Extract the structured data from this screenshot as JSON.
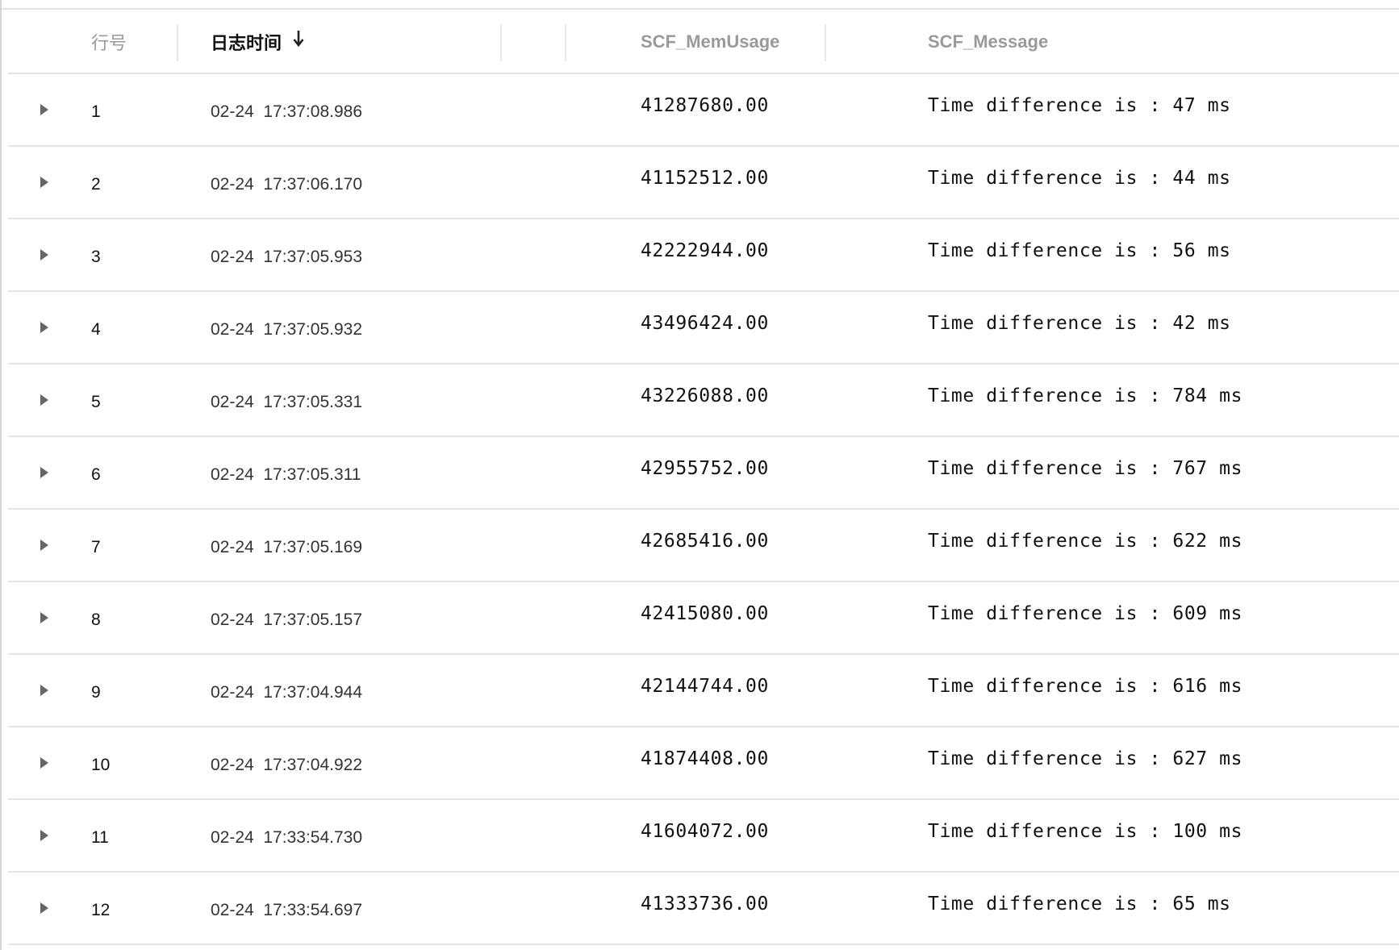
{
  "table": {
    "columns": {
      "row_no": "行号",
      "log_time": "日志时间",
      "mem_usage": "SCF_MemUsage",
      "message": "SCF_Message"
    },
    "sort": {
      "column": "log_time",
      "direction": "descending",
      "icon": "arrow-down-icon"
    },
    "expand_icon": "caret-right-icon",
    "rows": [
      {
        "no": "1",
        "time": "02-24  17:37:08.986",
        "mem": "41287680.00",
        "msg": "Time difference is : 47 ms"
      },
      {
        "no": "2",
        "time": "02-24  17:37:06.170",
        "mem": "41152512.00",
        "msg": "Time difference is : 44 ms"
      },
      {
        "no": "3",
        "time": "02-24  17:37:05.953",
        "mem": "42222944.00",
        "msg": "Time difference is : 56 ms"
      },
      {
        "no": "4",
        "time": "02-24  17:37:05.932",
        "mem": "43496424.00",
        "msg": "Time difference is : 42 ms"
      },
      {
        "no": "5",
        "time": "02-24  17:37:05.331",
        "mem": "43226088.00",
        "msg": "Time difference is : 784 ms"
      },
      {
        "no": "6",
        "time": "02-24  17:37:05.311",
        "mem": "42955752.00",
        "msg": "Time difference is : 767 ms"
      },
      {
        "no": "7",
        "time": "02-24  17:37:05.169",
        "mem": "42685416.00",
        "msg": "Time difference is : 622 ms"
      },
      {
        "no": "8",
        "time": "02-24  17:37:05.157",
        "mem": "42415080.00",
        "msg": "Time difference is : 609 ms"
      },
      {
        "no": "9",
        "time": "02-24  17:37:04.944",
        "mem": "42144744.00",
        "msg": "Time difference is : 616 ms"
      },
      {
        "no": "10",
        "time": "02-24  17:37:04.922",
        "mem": "41874408.00",
        "msg": "Time difference is : 627 ms"
      },
      {
        "no": "11",
        "time": "02-24  17:33:54.730",
        "mem": "41604072.00",
        "msg": "Time difference is : 100 ms"
      },
      {
        "no": "12",
        "time": "02-24  17:33:54.697",
        "mem": "41333736.00",
        "msg": "Time difference is : 65 ms"
      }
    ]
  }
}
